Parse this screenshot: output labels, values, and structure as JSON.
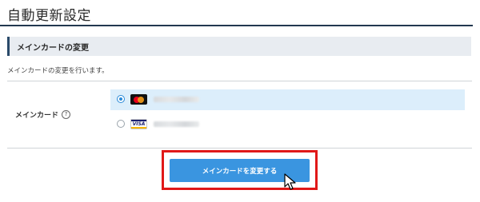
{
  "page": {
    "title": "自動更新設定"
  },
  "section": {
    "header": "メインカードの変更",
    "description": "メインカードの変更を行います。"
  },
  "main_card": {
    "label": "メインカード",
    "help_icon": "?",
    "options": [
      {
        "brand": "mastercard",
        "icon": "mastercard-icon",
        "selected": true,
        "number_visible": false
      },
      {
        "brand": "visa",
        "icon": "visa-icon",
        "brand_text": "VISA",
        "selected": false,
        "number_visible": false
      }
    ]
  },
  "actions": {
    "submit_label": "メインカードを変更する"
  },
  "colors": {
    "accent": "#3a95e0",
    "selected_row": "#dceefb",
    "highlight": "#e01818",
    "title_rule": "#22384f"
  }
}
